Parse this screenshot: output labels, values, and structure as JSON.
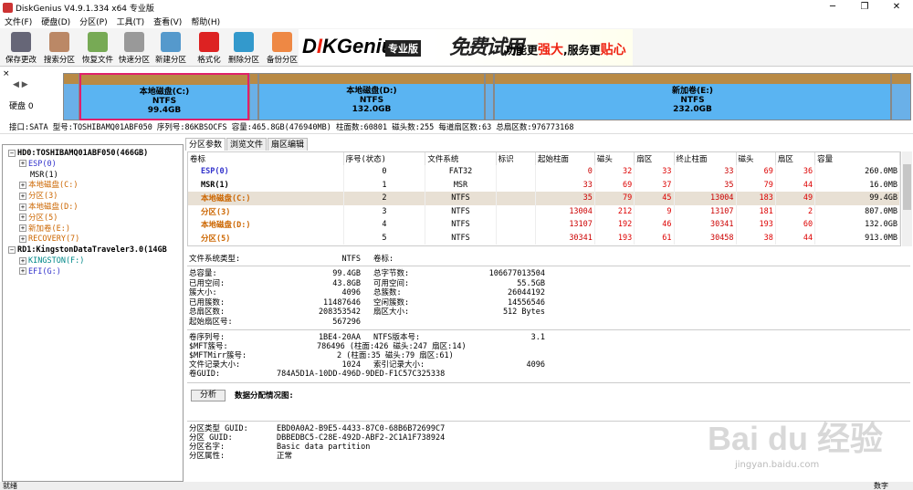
{
  "window": {
    "title": "DiskGenius V4.9.1.334 x64 专业版",
    "minimize": "─",
    "restore": "❐",
    "close": "✕"
  },
  "menu": [
    "文件(F)",
    "硬盘(D)",
    "分区(P)",
    "工具(T)",
    "查看(V)",
    "帮助(H)"
  ],
  "toolbar": [
    {
      "label": "保存更改",
      "icon": "save-icon",
      "color": "#667"
    },
    {
      "label": "搜索分区",
      "icon": "search-icon",
      "color": "#b86"
    },
    {
      "label": "恢复文件",
      "icon": "recover-icon",
      "color": "#7a5"
    },
    {
      "label": "快速分区",
      "icon": "quick-partition-icon",
      "color": "#999"
    },
    {
      "label": "新建分区",
      "icon": "new-partition-icon",
      "color": "#59c"
    },
    {
      "label": "格式化",
      "icon": "format-icon",
      "color": "#d22"
    },
    {
      "label": "删除分区",
      "icon": "delete-icon",
      "color": "#39c"
    },
    {
      "label": "备份分区",
      "icon": "backup-icon",
      "color": "#e84"
    }
  ],
  "banner": {
    "logo_a": "D",
    "logo_b": "I",
    "logo_c": "KGenius",
    "edition": "专业版",
    "free": "免费试用",
    "slogan_a": "功能更",
    "slogan_b": "强大",
    "slogan_c": ",服务更",
    "slogan_d": "贴心"
  },
  "diskbar": {
    "close": "×",
    "arrows": "◀ ▶",
    "disk_label": "硬盘 0",
    "partitions": [
      {
        "name": "本地磁盘(C:)",
        "fs": "NTFS",
        "size": "99.4GB"
      },
      {
        "name": "本地磁盘(D:)",
        "fs": "NTFS",
        "size": "132.0GB"
      },
      {
        "name": "新加卷(E:)",
        "fs": "NTFS",
        "size": "232.0GB"
      }
    ]
  },
  "diskinfo": "接口:SATA  型号:TOSHIBAMQ01ABF050  序列号:86KBSOCFS  容量:465.8GB(476940MB)  柱面数:60801  磁头数:255  每道扇区数:63  总扇区数:976773168",
  "tree": [
    {
      "label": "HD0:TOSHIBAMQ01ABF050(466GB)",
      "cls": "",
      "lvl": 0,
      "box": "−"
    },
    {
      "label": "ESP(0)",
      "cls": "blue",
      "lvl": 1,
      "box": "+"
    },
    {
      "label": "MSR(1)",
      "cls": "",
      "lvl": 1,
      "box": ""
    },
    {
      "label": "本地磁盘(C:)",
      "cls": "orange",
      "lvl": 1,
      "box": "+"
    },
    {
      "label": "分区(3)",
      "cls": "orange",
      "lvl": 1,
      "box": "+"
    },
    {
      "label": "本地磁盘(D:)",
      "cls": "orange",
      "lvl": 1,
      "box": "+"
    },
    {
      "label": "分区(5)",
      "cls": "orange",
      "lvl": 1,
      "box": "+"
    },
    {
      "label": "新加卷(E:)",
      "cls": "orange",
      "lvl": 1,
      "box": "+"
    },
    {
      "label": "RECOVERY(7)",
      "cls": "orange",
      "lvl": 1,
      "box": "+"
    },
    {
      "label": "RD1:KingstonDataTraveler3.0(14GB",
      "cls": "",
      "lvl": 0,
      "box": "−"
    },
    {
      "label": "KINGSTON(F:)",
      "cls": "teal",
      "lvl": 1,
      "box": "+"
    },
    {
      "label": "EFI(G:)",
      "cls": "blue",
      "lvl": 1,
      "box": "+"
    }
  ],
  "tabs": [
    "分区参数",
    "浏览文件",
    "扇区编辑"
  ],
  "table": {
    "headers": [
      "卷标",
      "序号(状态)",
      "文件系统",
      "标识",
      "起始柱面",
      "磁头",
      "扇区",
      "终止柱面",
      "磁头",
      "扇区",
      "容量"
    ],
    "rows": [
      [
        "ESP(0)",
        "0",
        "FAT32",
        "",
        "0",
        "32",
        "33",
        "33",
        "69",
        "36",
        "260.0MB"
      ],
      [
        "MSR(1)",
        "1",
        "MSR",
        "",
        "33",
        "69",
        "37",
        "35",
        "79",
        "44",
        "16.0MB"
      ],
      [
        "本地磁盘(C:)",
        "2",
        "NTFS",
        "",
        "35",
        "79",
        "45",
        "13004",
        "183",
        "49",
        "99.4GB"
      ],
      [
        "分区(3)",
        "3",
        "NTFS",
        "",
        "13004",
        "212",
        "9",
        "13107",
        "181",
        "2",
        "807.0MB"
      ],
      [
        "本地磁盘(D:)",
        "4",
        "NTFS",
        "",
        "13107",
        "192",
        "46",
        "30341",
        "193",
        "60",
        "132.0GB"
      ],
      [
        "分区(5)",
        "5",
        "NTFS",
        "",
        "30341",
        "193",
        "61",
        "30458",
        "38",
        "44",
        "913.0MB"
      ]
    ]
  },
  "details": {
    "fs_type_label": "文件系统类型:",
    "fs_type": "NTFS",
    "vol_label": "卷标:",
    "left": [
      [
        "总容量:",
        "99.4GB"
      ],
      [
        "已用空间:",
        "43.8GB"
      ],
      [
        "簇大小:",
        "4096"
      ],
      [
        "已用簇数:",
        "11487646"
      ],
      [
        "总扇区数:",
        "208353542"
      ],
      [
        "起始扇区号:",
        "567296"
      ]
    ],
    "right": [
      [
        "总字节数:",
        "106677013504"
      ],
      [
        "可用空间:",
        "55.5GB"
      ],
      [
        "总簇数:",
        "26044192"
      ],
      [
        "空闲簇数:",
        "14556546"
      ],
      [
        "扇区大小:",
        "512 Bytes"
      ]
    ],
    "serial_label": "卷序列号:",
    "serial": "1BE4-20AA",
    "ntfs_ver_label": "NTFS版本号:",
    "ntfs_ver": "3.1",
    "mft_label": "$MFT簇号:",
    "mft": "786496 (柱面:426 磁头:247 扇区:14)",
    "mftmirr_label": "$MFTMirr簇号:",
    "mftmirr": "2 (柱面:35 磁头:79 扇区:61)",
    "rec_label": "文件记录大小:",
    "rec": "1024",
    "idx_label": "索引记录大小:",
    "idx": "4096",
    "guid_label": "卷GUID:",
    "guid": "784A5D1A-10DD-496D-9DED-F1C57C325338",
    "analyze": "分析",
    "dist_label": "数据分配情况图:",
    "ptype_label": "分区类型 GUID:",
    "ptype": "EBD0A0A2-B9E5-4433-87C0-68B6B72699C7",
    "pguid_label": "分区 GUID:",
    "pguid": "DBBEDBC5-C28E-492D-ABF2-2C1A1F738924",
    "pname_label": "分区名字:",
    "pname": "Basic data partition",
    "pattr_label": "分区属性:",
    "pattr": "正常"
  },
  "status": {
    "left": "就绪",
    "right": "数字"
  },
  "watermark": {
    "brand": "Bai du 经验",
    "url": "jingyan.baidu.com"
  }
}
